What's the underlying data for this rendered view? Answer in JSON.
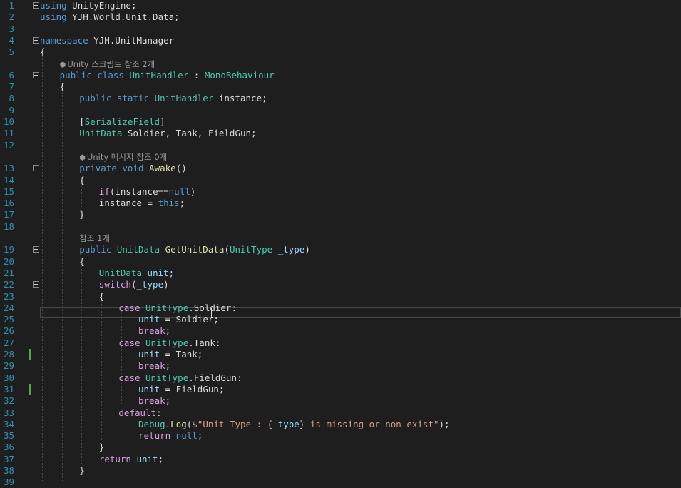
{
  "editor": {
    "lines": [
      {
        "n": "1",
        "fold": true,
        "indent": 0,
        "tokens": [
          [
            "kw",
            "using"
          ],
          [
            "pl",
            " UnityEngine;"
          ]
        ]
      },
      {
        "n": "2",
        "fold": false,
        "indent": 0,
        "tokens": [
          [
            "kw",
            "using"
          ],
          [
            "pl",
            " YJH.World.Unit.Data;"
          ]
        ]
      },
      {
        "n": "3",
        "fold": false,
        "indent": 0,
        "tokens": []
      },
      {
        "n": "4",
        "fold": true,
        "indent": 0,
        "tokens": [
          [
            "kw",
            "namespace"
          ],
          [
            "pl",
            " YJH.UnitManager"
          ]
        ]
      },
      {
        "n": "5",
        "fold": false,
        "indent": 0,
        "tokens": [
          [
            "pl",
            "{"
          ]
        ]
      },
      {
        "n": "6",
        "fold": true,
        "indent": 4,
        "lens": "Unity 스크립트|참조 2개",
        "lens_icon": true,
        "tokens": [
          [
            "kw",
            "public"
          ],
          [
            "pl",
            " "
          ],
          [
            "kw",
            "class"
          ],
          [
            "pl",
            " "
          ],
          [
            "ty",
            "UnitHandler"
          ],
          [
            "pl",
            " : "
          ],
          [
            "ty",
            "MonoBehaviour"
          ]
        ]
      },
      {
        "n": "7",
        "fold": false,
        "indent": 4,
        "tokens": [
          [
            "pl",
            "{"
          ]
        ]
      },
      {
        "n": "8",
        "fold": false,
        "indent": 8,
        "tokens": [
          [
            "kw",
            "public"
          ],
          [
            "pl",
            " "
          ],
          [
            "kw",
            "static"
          ],
          [
            "pl",
            " "
          ],
          [
            "ty",
            "UnitHandler"
          ],
          [
            "pl",
            " instance;"
          ]
        ]
      },
      {
        "n": "9",
        "fold": false,
        "indent": 8,
        "tokens": []
      },
      {
        "n": "10",
        "fold": false,
        "indent": 8,
        "tokens": [
          [
            "pl",
            "["
          ],
          [
            "ty",
            "SerializeField"
          ],
          [
            "pl",
            "]"
          ]
        ]
      },
      {
        "n": "11",
        "fold": false,
        "indent": 8,
        "tokens": [
          [
            "ty",
            "UnitData"
          ],
          [
            "pl",
            " Soldier, Tank, FieldGun;"
          ]
        ]
      },
      {
        "n": "12",
        "fold": false,
        "indent": 8,
        "tokens": []
      },
      {
        "n": "13",
        "fold": true,
        "indent": 8,
        "lens": "Unity 메시지|참조 0개",
        "lens_icon": true,
        "tokens": [
          [
            "kw",
            "private"
          ],
          [
            "pl",
            " "
          ],
          [
            "kw",
            "void"
          ],
          [
            "pl",
            " "
          ],
          [
            "fn",
            "Awake"
          ],
          [
            "pl",
            "()"
          ]
        ]
      },
      {
        "n": "14",
        "fold": false,
        "indent": 8,
        "tokens": [
          [
            "pl",
            "{"
          ]
        ]
      },
      {
        "n": "15",
        "fold": false,
        "indent": 12,
        "tokens": [
          [
            "ctl",
            "if"
          ],
          [
            "pl",
            "(instance=="
          ],
          [
            "kw",
            "null"
          ],
          [
            "pl",
            ")"
          ]
        ]
      },
      {
        "n": "16",
        "fold": false,
        "indent": 12,
        "tokens": [
          [
            "pl",
            "instance = "
          ],
          [
            "kw",
            "this"
          ],
          [
            "pl",
            ";"
          ]
        ]
      },
      {
        "n": "17",
        "fold": false,
        "indent": 8,
        "tokens": [
          [
            "pl",
            "}"
          ]
        ]
      },
      {
        "n": "18",
        "fold": false,
        "indent": 8,
        "tokens": []
      },
      {
        "n": "19",
        "fold": true,
        "indent": 8,
        "lens": "참조 1개",
        "lens_icon": false,
        "tokens": [
          [
            "kw",
            "public"
          ],
          [
            "pl",
            " "
          ],
          [
            "ty",
            "UnitData"
          ],
          [
            "pl",
            " "
          ],
          [
            "fn",
            "GetUnitData"
          ],
          [
            "pl",
            "("
          ],
          [
            "ty",
            "UnitType"
          ],
          [
            "pl",
            " "
          ],
          [
            "var",
            "_type"
          ],
          [
            "pl",
            ")"
          ]
        ]
      },
      {
        "n": "20",
        "fold": false,
        "indent": 8,
        "tokens": [
          [
            "pl",
            "{"
          ]
        ]
      },
      {
        "n": "21",
        "fold": false,
        "indent": 12,
        "tokens": [
          [
            "ty",
            "UnitData"
          ],
          [
            "pl",
            " "
          ],
          [
            "var",
            "unit"
          ],
          [
            "pl",
            ";"
          ]
        ]
      },
      {
        "n": "22",
        "fold": true,
        "indent": 12,
        "tokens": [
          [
            "ctl",
            "switch"
          ],
          [
            "pl",
            "("
          ],
          [
            "var",
            "_type"
          ],
          [
            "pl",
            ")"
          ]
        ]
      },
      {
        "n": "23",
        "fold": false,
        "indent": 12,
        "tokens": [
          [
            "pl",
            "{"
          ]
        ]
      },
      {
        "n": "24",
        "fold": false,
        "indent": 16,
        "tokens": [
          [
            "ctl",
            "case"
          ],
          [
            "pl",
            " "
          ],
          [
            "ty",
            "UnitType"
          ],
          [
            "pl",
            ".Soldier:"
          ]
        ]
      },
      {
        "n": "25",
        "fold": false,
        "indent": 20,
        "tokens": [
          [
            "var",
            "unit"
          ],
          [
            "pl",
            " = Soldier;"
          ]
        ]
      },
      {
        "n": "26",
        "fold": false,
        "indent": 20,
        "tokens": [
          [
            "ctl",
            "break"
          ],
          [
            "pl",
            ";"
          ]
        ]
      },
      {
        "n": "27",
        "fold": false,
        "indent": 16,
        "tokens": [
          [
            "ctl",
            "case"
          ],
          [
            "pl",
            " "
          ],
          [
            "ty",
            "UnitType"
          ],
          [
            "pl",
            ".Tank:"
          ]
        ]
      },
      {
        "n": "28",
        "fold": false,
        "indent": 20,
        "changed": true,
        "tokens": [
          [
            "var",
            "unit"
          ],
          [
            "pl",
            " = Tank;"
          ]
        ]
      },
      {
        "n": "29",
        "fold": false,
        "indent": 20,
        "tokens": [
          [
            "ctl",
            "break"
          ],
          [
            "pl",
            ";"
          ]
        ]
      },
      {
        "n": "30",
        "fold": false,
        "indent": 16,
        "tokens": [
          [
            "ctl",
            "case"
          ],
          [
            "pl",
            " "
          ],
          [
            "ty",
            "UnitType"
          ],
          [
            "pl",
            ".FieldGun:"
          ]
        ]
      },
      {
        "n": "31",
        "fold": false,
        "indent": 20,
        "changed": true,
        "tokens": [
          [
            "var",
            "unit"
          ],
          [
            "pl",
            " = FieldGun;"
          ]
        ]
      },
      {
        "n": "32",
        "fold": false,
        "indent": 20,
        "tokens": [
          [
            "ctl",
            "break"
          ],
          [
            "pl",
            ";"
          ]
        ]
      },
      {
        "n": "33",
        "fold": false,
        "indent": 16,
        "tokens": [
          [
            "ctl",
            "default"
          ],
          [
            "pl",
            ":"
          ]
        ]
      },
      {
        "n": "34",
        "fold": false,
        "indent": 20,
        "tokens": [
          [
            "ty",
            "Debug"
          ],
          [
            "pl",
            "."
          ],
          [
            "fn",
            "Log"
          ],
          [
            "pl",
            "("
          ],
          [
            "str",
            "$\"Unit Type : "
          ],
          [
            "pl",
            "{"
          ],
          [
            "var",
            "_type"
          ],
          [
            "pl",
            "}"
          ],
          [
            "str",
            " is missing or non-exist\""
          ],
          [
            "pl",
            ");"
          ]
        ]
      },
      {
        "n": "35",
        "fold": false,
        "indent": 20,
        "tokens": [
          [
            "ctl",
            "return"
          ],
          [
            "pl",
            " "
          ],
          [
            "kw",
            "null"
          ],
          [
            "pl",
            ";"
          ]
        ]
      },
      {
        "n": "36",
        "fold": false,
        "indent": 12,
        "tokens": [
          [
            "pl",
            "}"
          ]
        ]
      },
      {
        "n": "37",
        "fold": false,
        "indent": 12,
        "tokens": [
          [
            "ctl",
            "return"
          ],
          [
            "pl",
            " "
          ],
          [
            "var",
            "unit"
          ],
          [
            "pl",
            ";"
          ]
        ]
      },
      {
        "n": "38",
        "fold": false,
        "indent": 8,
        "tokens": [
          [
            "pl",
            "}"
          ]
        ]
      },
      {
        "n": "39",
        "fold": false,
        "indent": 8,
        "tokens": []
      }
    ],
    "current_line": "25",
    "colors": {
      "keyword": "#569cd6",
      "control": "#d8a0df",
      "type": "#4ec9b0",
      "method": "#dcdcaa",
      "string": "#d69d85",
      "identifier": "#9cdcfe",
      "plain": "#dcdcdc",
      "line_number": "#2b91af",
      "background": "#1e1e1e",
      "change_marker": "#57a64a"
    }
  }
}
